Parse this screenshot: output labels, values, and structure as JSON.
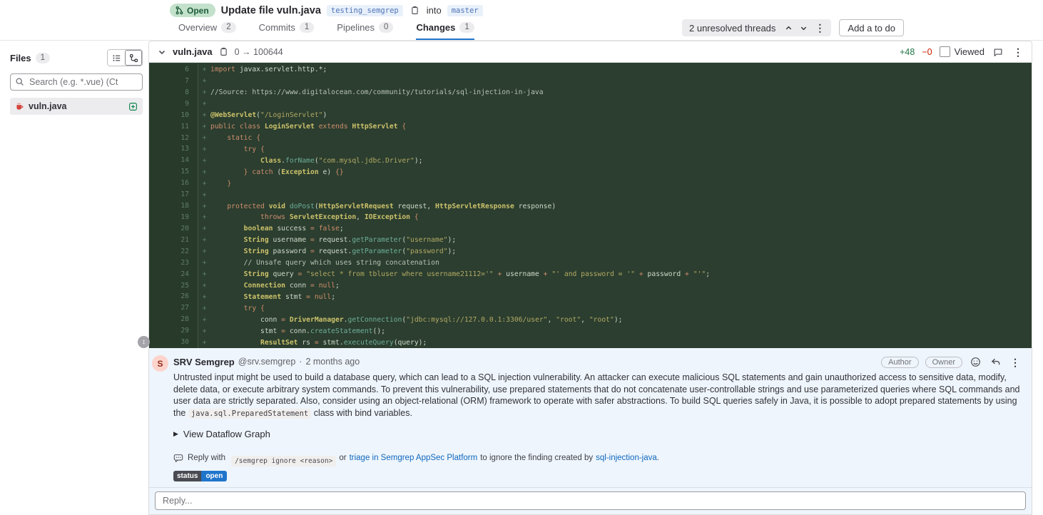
{
  "header": {
    "state_badge": "Open",
    "title": "Update file vuln.java",
    "source_branch": "testing_semgrep",
    "into_label": "into",
    "target_branch": "master",
    "tabs": [
      {
        "label": "Overview",
        "count": "2",
        "active": false
      },
      {
        "label": "Commits",
        "count": "1",
        "active": false
      },
      {
        "label": "Pipelines",
        "count": "0",
        "active": false
      },
      {
        "label": "Changes",
        "count": "1",
        "active": true
      }
    ],
    "threads_label": "2 unresolved threads",
    "todo_button": "Add a to do"
  },
  "sidebar": {
    "files_label": "Files",
    "files_count": "1",
    "search_placeholder": "Search (e.g. *.vue) (Ct",
    "files": [
      {
        "name": "vuln.java"
      }
    ]
  },
  "diff": {
    "file_name": "vuln.java",
    "mode_change": "0 → 100644",
    "added": "+48",
    "removed": "−0",
    "viewed_label": "Viewed",
    "lines": [
      {
        "n": "6",
        "code": "import javax.servlet.http.*;"
      },
      {
        "n": "7",
        "code": ""
      },
      {
        "n": "8",
        "code": "//Source: https://www.digitalocean.com/community/tutorials/sql-injection-in-java"
      },
      {
        "n": "9",
        "code": ""
      },
      {
        "n": "10",
        "code": "@WebServlet(\"/LoginServlet\")"
      },
      {
        "n": "11",
        "code": "public class LoginServlet extends HttpServlet {"
      },
      {
        "n": "12",
        "code": "    static {"
      },
      {
        "n": "13",
        "code": "        try {"
      },
      {
        "n": "14",
        "code": "            Class.forName(\"com.mysql.jdbc.Driver\");"
      },
      {
        "n": "15",
        "code": "        } catch (Exception e) {}"
      },
      {
        "n": "16",
        "code": "    }"
      },
      {
        "n": "17",
        "code": ""
      },
      {
        "n": "18",
        "code": "    protected void doPost(HttpServletRequest request, HttpServletResponse response)"
      },
      {
        "n": "19",
        "code": "            throws ServletException, IOException {"
      },
      {
        "n": "20",
        "code": "        boolean success = false;"
      },
      {
        "n": "21",
        "code": "        String username = request.getParameter(\"username\");"
      },
      {
        "n": "22",
        "code": "        String password = request.getParameter(\"password\");"
      },
      {
        "n": "23",
        "code": "        // Unsafe query which uses string concatenation"
      },
      {
        "n": "24",
        "code": "        String query = \"select * from tbluser where username21112='\" + username + \"' and password = '\" + password + \"'\";"
      },
      {
        "n": "25",
        "code": "        Connection conn = null;"
      },
      {
        "n": "26",
        "code": "        Statement stmt = null;"
      },
      {
        "n": "27",
        "code": "        try {"
      },
      {
        "n": "28",
        "code": "            conn = DriverManager.getConnection(\"jdbc:mysql://127.0.0.1:3306/user\", \"root\", \"root\");"
      },
      {
        "n": "29",
        "code": "            stmt = conn.createStatement();"
      },
      {
        "n": "30",
        "code": "            ResultSet rs = stmt.executeQuery(query);"
      }
    ]
  },
  "discussion": {
    "avatar_letter": "S",
    "author_name": "SRV Semgrep",
    "author_handle": "@srv.semgrep",
    "separator": "·",
    "timestamp": "2 months ago",
    "badges": [
      "Author",
      "Owner"
    ],
    "body_part1": "Untrusted input might be used to build a database query, which can lead to a SQL injection vulnerability. An attacker can execute malicious SQL statements and gain unauthorized access to sensitive data, modify, delete data, or execute arbitrary system commands. To prevent this vulnerability, use prepared statements that do not concatenate user-controllable strings and use parameterized queries where SQL commands and user data are strictly separated. Also, consider using an object-relational (ORM) framework to operate with safer abstractions. To build SQL queries safely in Java, it is possible to adopt prepared statements by using the ",
    "body_code": "java.sql.PreparedStatement",
    "body_part2": " class with bind variables.",
    "dataflow_toggle": "View Dataflow Graph",
    "reply_hint": {
      "prefix": "Reply with",
      "code": "/semgrep ignore <reason>",
      "middle": "or",
      "link1": "triage in Semgrep AppSec Platform",
      "middle2": "to ignore the finding created by",
      "link2": "sql-injection-java",
      "suffix": "."
    },
    "status_badge": {
      "key": "status",
      "value": "open"
    }
  },
  "reply": {
    "placeholder": "Reply..."
  },
  "colors": {
    "accent_blue": "#1f75cb",
    "link_blue": "#1068bf",
    "added_green": "#217645",
    "removed_red": "#c91c00",
    "open_badge_bg": "#c3e1cb",
    "diff_bg": "#2b3e2f",
    "discussion_bg": "#eef5fc"
  }
}
